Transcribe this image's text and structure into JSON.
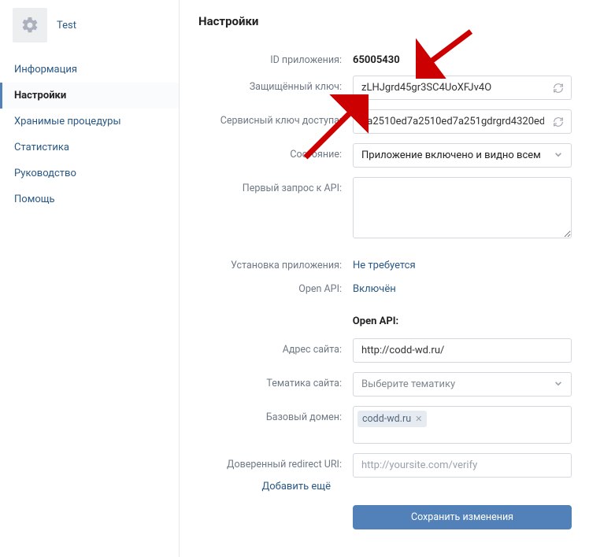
{
  "sidebar": {
    "title": "Test",
    "items": [
      {
        "label": "Информация"
      },
      {
        "label": "Настройки",
        "active": true
      },
      {
        "label": "Хранимые процедуры"
      },
      {
        "label": "Статистика"
      },
      {
        "label": "Руководство"
      },
      {
        "label": "Помощь"
      }
    ]
  },
  "page": {
    "title": "Настройки"
  },
  "fields": {
    "app_id_label": "ID приложения:",
    "app_id_value": "65005430",
    "secret_label": "Защищённый ключ:",
    "secret_value": "zLHJgrd45gr3SC4UoXFJv4O",
    "service_label": "Сервисный ключ доступа:",
    "service_value": "7a2510ed7a2510ed7a251gdrgrd4320ed",
    "state_label": "Состояние:",
    "state_value": "Приложение включено и видно всем",
    "first_request_label": "Первый запрос к API:",
    "install_label": "Установка приложения:",
    "install_value": "Не требуется",
    "openapi_label": "Open API:",
    "openapi_value": "Включён",
    "section_openapi": "Open API:",
    "site_label": "Адрес сайта:",
    "site_value": "http://codd-wd.ru/",
    "theme_label": "Тематика сайта:",
    "theme_placeholder": "Выберите тематику",
    "base_domain_label": "Базовый домен:",
    "base_domain_tag": "codd-wd.ru",
    "redirect_label": "Доверенный redirect URI:",
    "redirect_placeholder": "http://yoursite.com/verify",
    "add_more": "Добавить ещё",
    "save_btn": "Сохранить изменения"
  }
}
